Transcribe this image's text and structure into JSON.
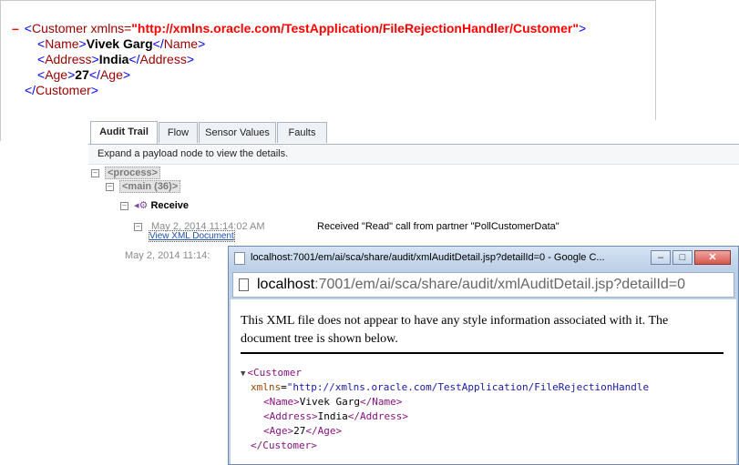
{
  "top_xml": {
    "lines": [
      {
        "minus": "–",
        "open": "<",
        "tag": "Customer",
        "attr_name": " xmlns=",
        "attr_value": "\"http://xmlns.oracle.com/TestApplication/FileRejectionHandler/Customer\"",
        "close": ">"
      },
      {
        "open": "<",
        "tag": "Name",
        "mid": ">",
        "text": "Vivek Garg",
        "end_open": "</",
        "end_tag": "Name",
        "close": ">"
      },
      {
        "open": "<",
        "tag": "Address",
        "mid": ">",
        "text": "India",
        "end_open": "</",
        "end_tag": "Address",
        "close": ">"
      },
      {
        "open": "<",
        "tag": "Age",
        "mid": ">",
        "text": "27",
        "end_open": "</",
        "end_tag": "Age",
        "close": ">"
      },
      {
        "open": "</",
        "tag": "Customer",
        "close": ">"
      }
    ]
  },
  "audit": {
    "tabs": [
      "Audit Trail",
      "Flow",
      "Sensor Values",
      "Faults"
    ],
    "hint": "Expand a payload node to view the details.",
    "tree": {
      "process": "<process>",
      "main": "<main (36)>",
      "receive": "Receive",
      "timestamp": "May 2, 2014 11:14:02 AM",
      "message": "Received \"Read\" call from partner \"PollCustomerData\"",
      "view_link": "View XML Document",
      "partial_ts": "May 2, 2014 11:14:"
    }
  },
  "popup": {
    "title": "localhost:7001/em/ai/sca/share/audit/xmlAuditDetail.jsp?detailId=0 - Google C...",
    "url_host": "localhost",
    "url_path": ":7001/em/ai/sca/share/audit/xmlAuditDetail.jsp?detailId=0",
    "notice": "This XML file does not appear to have any style information associated with it. The document tree is shown below.",
    "xml": {
      "caret": "▼",
      "root_open": "<Customer",
      "xmlns_name": "xmlns",
      "xmlns_eq": "=",
      "xmlns_value": "\"http://xmlns.oracle.com/TestApplication/FileRejectionHandle",
      "name_open": "<Name>",
      "name_val": "Vivek Garg",
      "name_close": "</Name>",
      "addr_open": "<Address>",
      "addr_val": "India",
      "addr_close": "</Address>",
      "age_open": "<Age>",
      "age_val": "27",
      "age_close": "</Age>",
      "root_close": "</Customer>"
    },
    "buttons": {
      "minimize": "–",
      "maximize": "□",
      "close": "✕"
    }
  }
}
